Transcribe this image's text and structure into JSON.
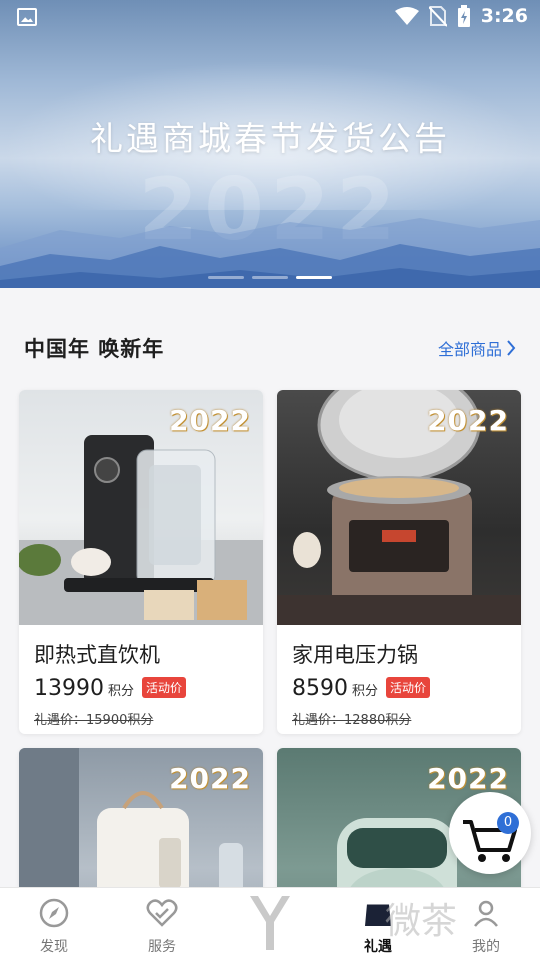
{
  "status_bar": {
    "time": "3:26"
  },
  "banner": {
    "headline": "礼遇商城春节发货公告",
    "year_watermark": "2022",
    "slides": 3,
    "active_slide": 3
  },
  "section": {
    "title": "中国年 唤新年",
    "link_label": "全部商品"
  },
  "products": [
    {
      "name": "即热式直饮机",
      "price": "13990",
      "unit": "积分",
      "tag": "活动价",
      "original": "礼遇价：15900积分",
      "badge": "2022"
    },
    {
      "name": "家用电压力锅",
      "price": "8590",
      "unit": "积分",
      "tag": "活动价",
      "original": "礼遇价：12880积分",
      "badge": "2022"
    },
    {
      "badge": "2022"
    },
    {
      "badge": "2022"
    }
  ],
  "cart": {
    "count": "0"
  },
  "nav": {
    "items": [
      {
        "label": "发现",
        "icon": "compass-icon"
      },
      {
        "label": "服务",
        "icon": "heart-icon"
      },
      {
        "label": "",
        "icon": "brand-logo-icon"
      },
      {
        "label": "礼遇",
        "icon": "gift-bag-icon"
      },
      {
        "label": "我的",
        "icon": "user-icon"
      }
    ],
    "watermark": "微茶"
  },
  "colors": {
    "accent": "#2f6fd6",
    "tag_red": "#e8453c"
  }
}
